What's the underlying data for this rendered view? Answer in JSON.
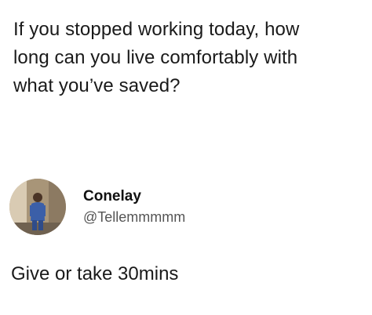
{
  "post": {
    "text": "If you stopped working today, how\nlong can you live comfortably with\nwhat you’ve saved?"
  },
  "reply": {
    "avatar_icon": "user-photo-avatar",
    "display_name": "Conelay",
    "handle": "@Tellemmmmm",
    "text": "Give or take 30mins"
  }
}
